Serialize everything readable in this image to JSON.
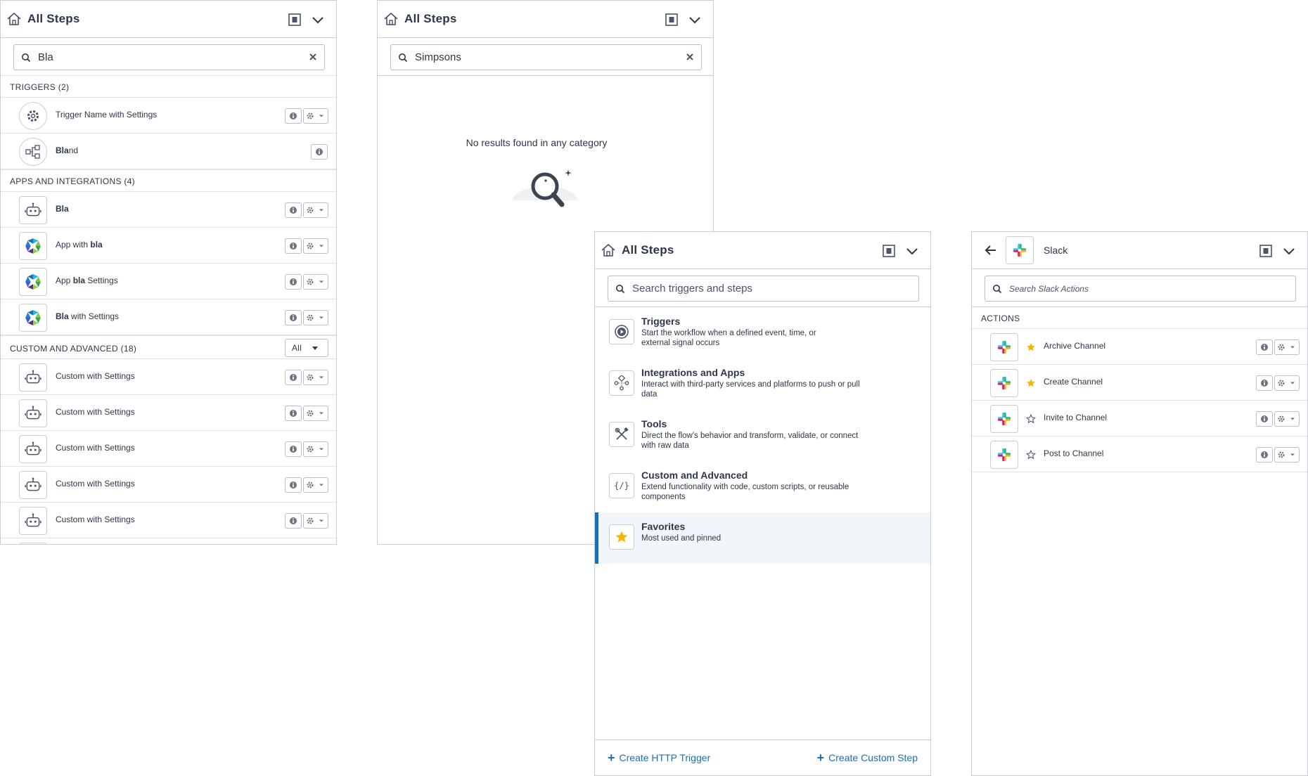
{
  "panel1": {
    "title": "All Steps",
    "search_value": "Bla",
    "triggers_header": "TRIGGERS (2)",
    "triggers": [
      {
        "label": "Trigger Name with Settings",
        "icon": "gear-cog-icon"
      },
      {
        "bold": "Bla",
        "rest": "nd",
        "icon": "flow-icon"
      }
    ],
    "apps_header": "APPS AND INTEGRATIONS (4)",
    "apps": [
      {
        "pre": "",
        "bold": "Bla",
        "post": ""
      },
      {
        "pre": "App with ",
        "bold": "bla",
        "post": ""
      },
      {
        "pre": "App ",
        "bold": "bla",
        "post": " Settings"
      },
      {
        "pre": "",
        "bold": "Bla",
        "post": " with Settings"
      }
    ],
    "custom_header": "CUSTOM AND ADVANCED (18)",
    "custom_filter": "All",
    "custom_items": [
      "Custom with Settings",
      "Custom with Settings",
      "Custom with Settings",
      "Custom with Settings",
      "Custom with Settings"
    ]
  },
  "panel2": {
    "title": "All Steps",
    "search_value": "Simpsons",
    "empty_message": "No results found in any category"
  },
  "panel3": {
    "title": "All Steps",
    "search_placeholder": "Search triggers and steps",
    "categories": [
      {
        "title": "Triggers",
        "desc": "Start the workflow when a defined event, time, or external signal occurs",
        "icon": "play-icon"
      },
      {
        "title": "Integrations and Apps",
        "desc": "Interact with third-party services and platforms to push or pull data",
        "icon": "integrations-icon"
      },
      {
        "title": "Tools",
        "desc": "Direct the flow's behavior and transform, validate, or connect with raw data",
        "icon": "tools-icon"
      },
      {
        "title": "Custom and Advanced",
        "desc": "Extend functionality with code, custom scripts, or reusable components",
        "icon": "code-icon"
      },
      {
        "title": "Favorites",
        "desc": "Most used and pinned",
        "icon": "star-icon"
      }
    ],
    "footer_left": "Create HTTP Trigger",
    "footer_right": "Create Custom Step",
    "accent_color": "#1b6fb3"
  },
  "panel4": {
    "title": "Slack",
    "search_placeholder": "Search Slack Actions",
    "actions_header": "ACTIONS",
    "actions": [
      {
        "label": "Archive Channel",
        "favorite": true
      },
      {
        "label": "Create Channel",
        "favorite": true
      },
      {
        "label": "Invite to Channel",
        "favorite": false
      },
      {
        "label": "Post to Channel",
        "favorite": false
      }
    ]
  }
}
